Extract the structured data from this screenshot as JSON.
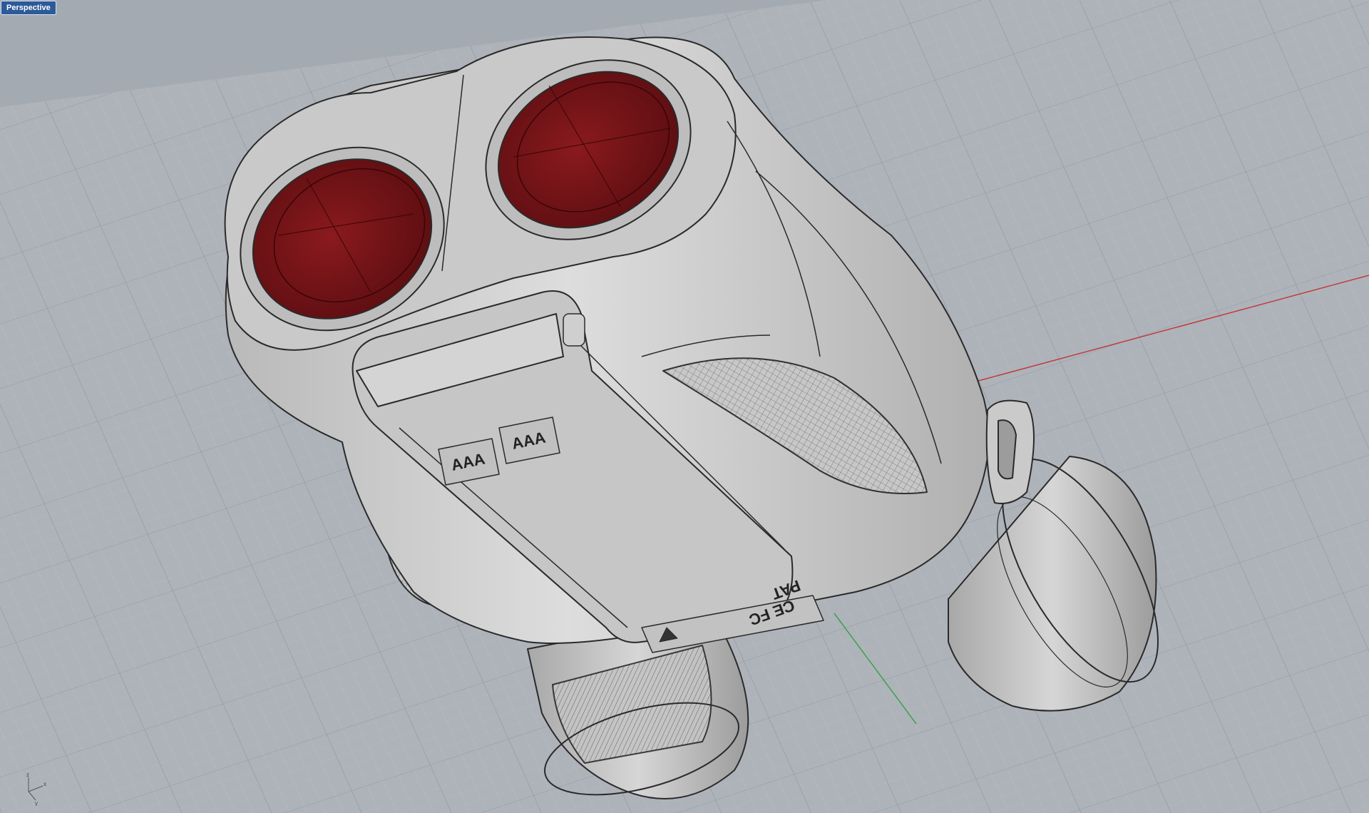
{
  "viewport": {
    "name": "Perspective"
  },
  "axis_widget": {
    "z": "z",
    "x": "x",
    "y": "y"
  },
  "product_labels": {
    "battery_left": "AAA",
    "battery_right": "AAA",
    "marking_top": "PAT",
    "marking_bottom": "CE FC"
  },
  "colors": {
    "background": "#a4aab2",
    "grid_minor": "#b9bec5",
    "grid_major": "#8f959d",
    "x_axis": "#c23a3a",
    "y_axis": "#3aa24a",
    "lens": "#7a1418",
    "body": "#cfcfcf",
    "outline": "#2a2a2a",
    "tab": "#2d5a99"
  }
}
